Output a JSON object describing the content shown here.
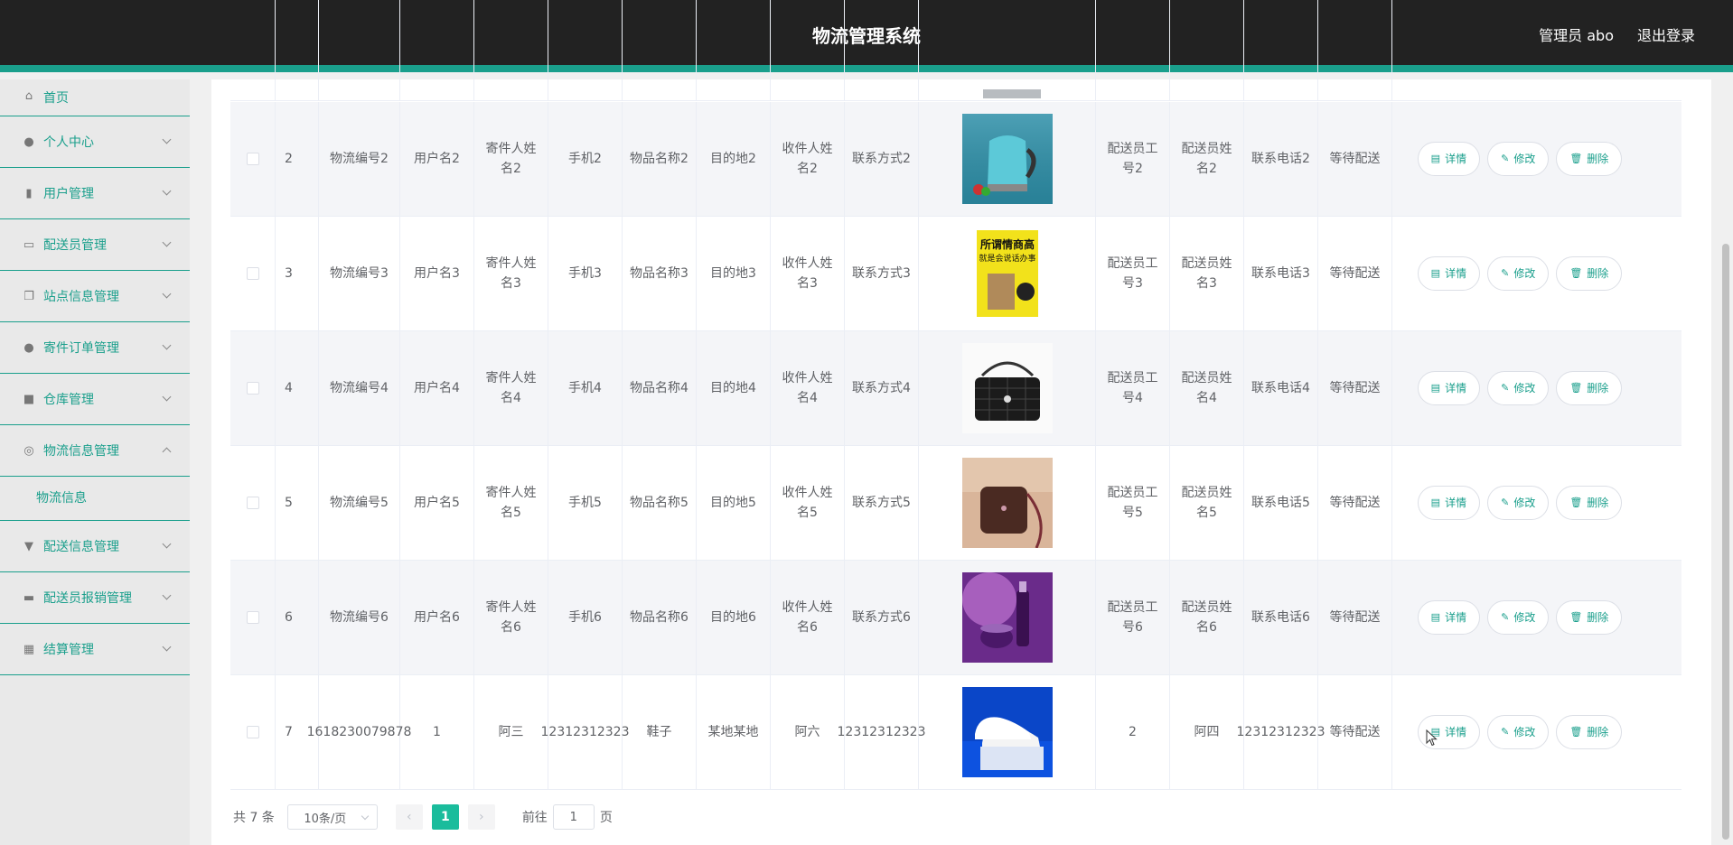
{
  "header": {
    "title": "物流管理系统",
    "user": "管理员 abo",
    "logout": "退出登录"
  },
  "sidebar": {
    "items": [
      {
        "label": "首页",
        "icon": "home-icon"
      },
      {
        "label": "个人中心",
        "icon": "user-icon"
      },
      {
        "label": "用户管理",
        "icon": "chart-icon"
      },
      {
        "label": "配送员管理",
        "icon": "id-card-icon"
      },
      {
        "label": "站点信息管理",
        "icon": "copy-icon"
      },
      {
        "label": "寄件订单管理",
        "icon": "bulb-icon"
      },
      {
        "label": "仓库管理",
        "icon": "briefcase-icon"
      },
      {
        "label": "物流信息管理",
        "icon": "globe-icon",
        "expanded": true,
        "sub": "物流信息"
      },
      {
        "label": "配送信息管理",
        "icon": "stamp-icon"
      },
      {
        "label": "配送员报销管理",
        "icon": "printer-icon"
      },
      {
        "label": "结算管理",
        "icon": "grid-icon"
      }
    ]
  },
  "table": {
    "rows": [
      {
        "idx": "2",
        "no": "物流编号2",
        "user": "用户名2",
        "sender": "寄件人姓名2",
        "phone": "手机2",
        "item": "物品名称2",
        "dest": "目的地2",
        "recv": "收件人姓名2",
        "contact": "联系方式2",
        "image": "kettle",
        "cid": "配送员工号2",
        "cname": "配送员姓名2",
        "ctel": "联系电话2",
        "status": "等待配送"
      },
      {
        "idx": "3",
        "no": "物流编号3",
        "user": "用户名3",
        "sender": "寄件人姓名3",
        "phone": "手机3",
        "item": "物品名称3",
        "dest": "目的地3",
        "recv": "收件人姓名3",
        "contact": "联系方式3",
        "image": "book",
        "cid": "配送员工号3",
        "cname": "配送员姓名3",
        "ctel": "联系电话3",
        "status": "等待配送"
      },
      {
        "idx": "4",
        "no": "物流编号4",
        "user": "用户名4",
        "sender": "寄件人姓名4",
        "phone": "手机4",
        "item": "物品名称4",
        "dest": "目的地4",
        "recv": "收件人姓名4",
        "contact": "联系方式4",
        "image": "black-bag",
        "cid": "配送员工号4",
        "cname": "配送员姓名4",
        "ctel": "联系电话4",
        "status": "等待配送"
      },
      {
        "idx": "5",
        "no": "物流编号5",
        "user": "用户名5",
        "sender": "寄件人姓名5",
        "phone": "手机5",
        "item": "物品名称5",
        "dest": "目的地5",
        "recv": "收件人姓名5",
        "contact": "联系方式5",
        "image": "brown-bag",
        "cid": "配送员工号5",
        "cname": "配送员姓名5",
        "ctel": "联系电话5",
        "status": "等待配送"
      },
      {
        "idx": "6",
        "no": "物流编号6",
        "user": "用户名6",
        "sender": "寄件人姓名6",
        "phone": "手机6",
        "item": "物品名称6",
        "dest": "目的地6",
        "recv": "收件人姓名6",
        "contact": "联系方式6",
        "image": "cosmetics",
        "cid": "配送员工号6",
        "cname": "配送员姓名6",
        "ctel": "联系电话6",
        "status": "等待配送"
      },
      {
        "idx": "7",
        "no": "1618230079878",
        "user": "1",
        "sender": "阿三",
        "phone": "12312312323",
        "item": "鞋子",
        "dest": "某地某地",
        "recv": "阿六",
        "contact": "12312312323",
        "image": "shoes",
        "cid": "2",
        "cname": "阿四",
        "ctel": "12312312323",
        "status": "等待配送"
      }
    ],
    "actions": {
      "detail": "详情",
      "edit": "修改",
      "delete": "删除"
    }
  },
  "pagination": {
    "total": "共 7 条",
    "page_size": "10条/页",
    "current": "1",
    "goto_label": "前往",
    "goto_value": "1",
    "page_unit": "页"
  },
  "colors": {
    "accent": "#1a9f8c",
    "header": "#222222",
    "active_page": "#1abc9c"
  }
}
